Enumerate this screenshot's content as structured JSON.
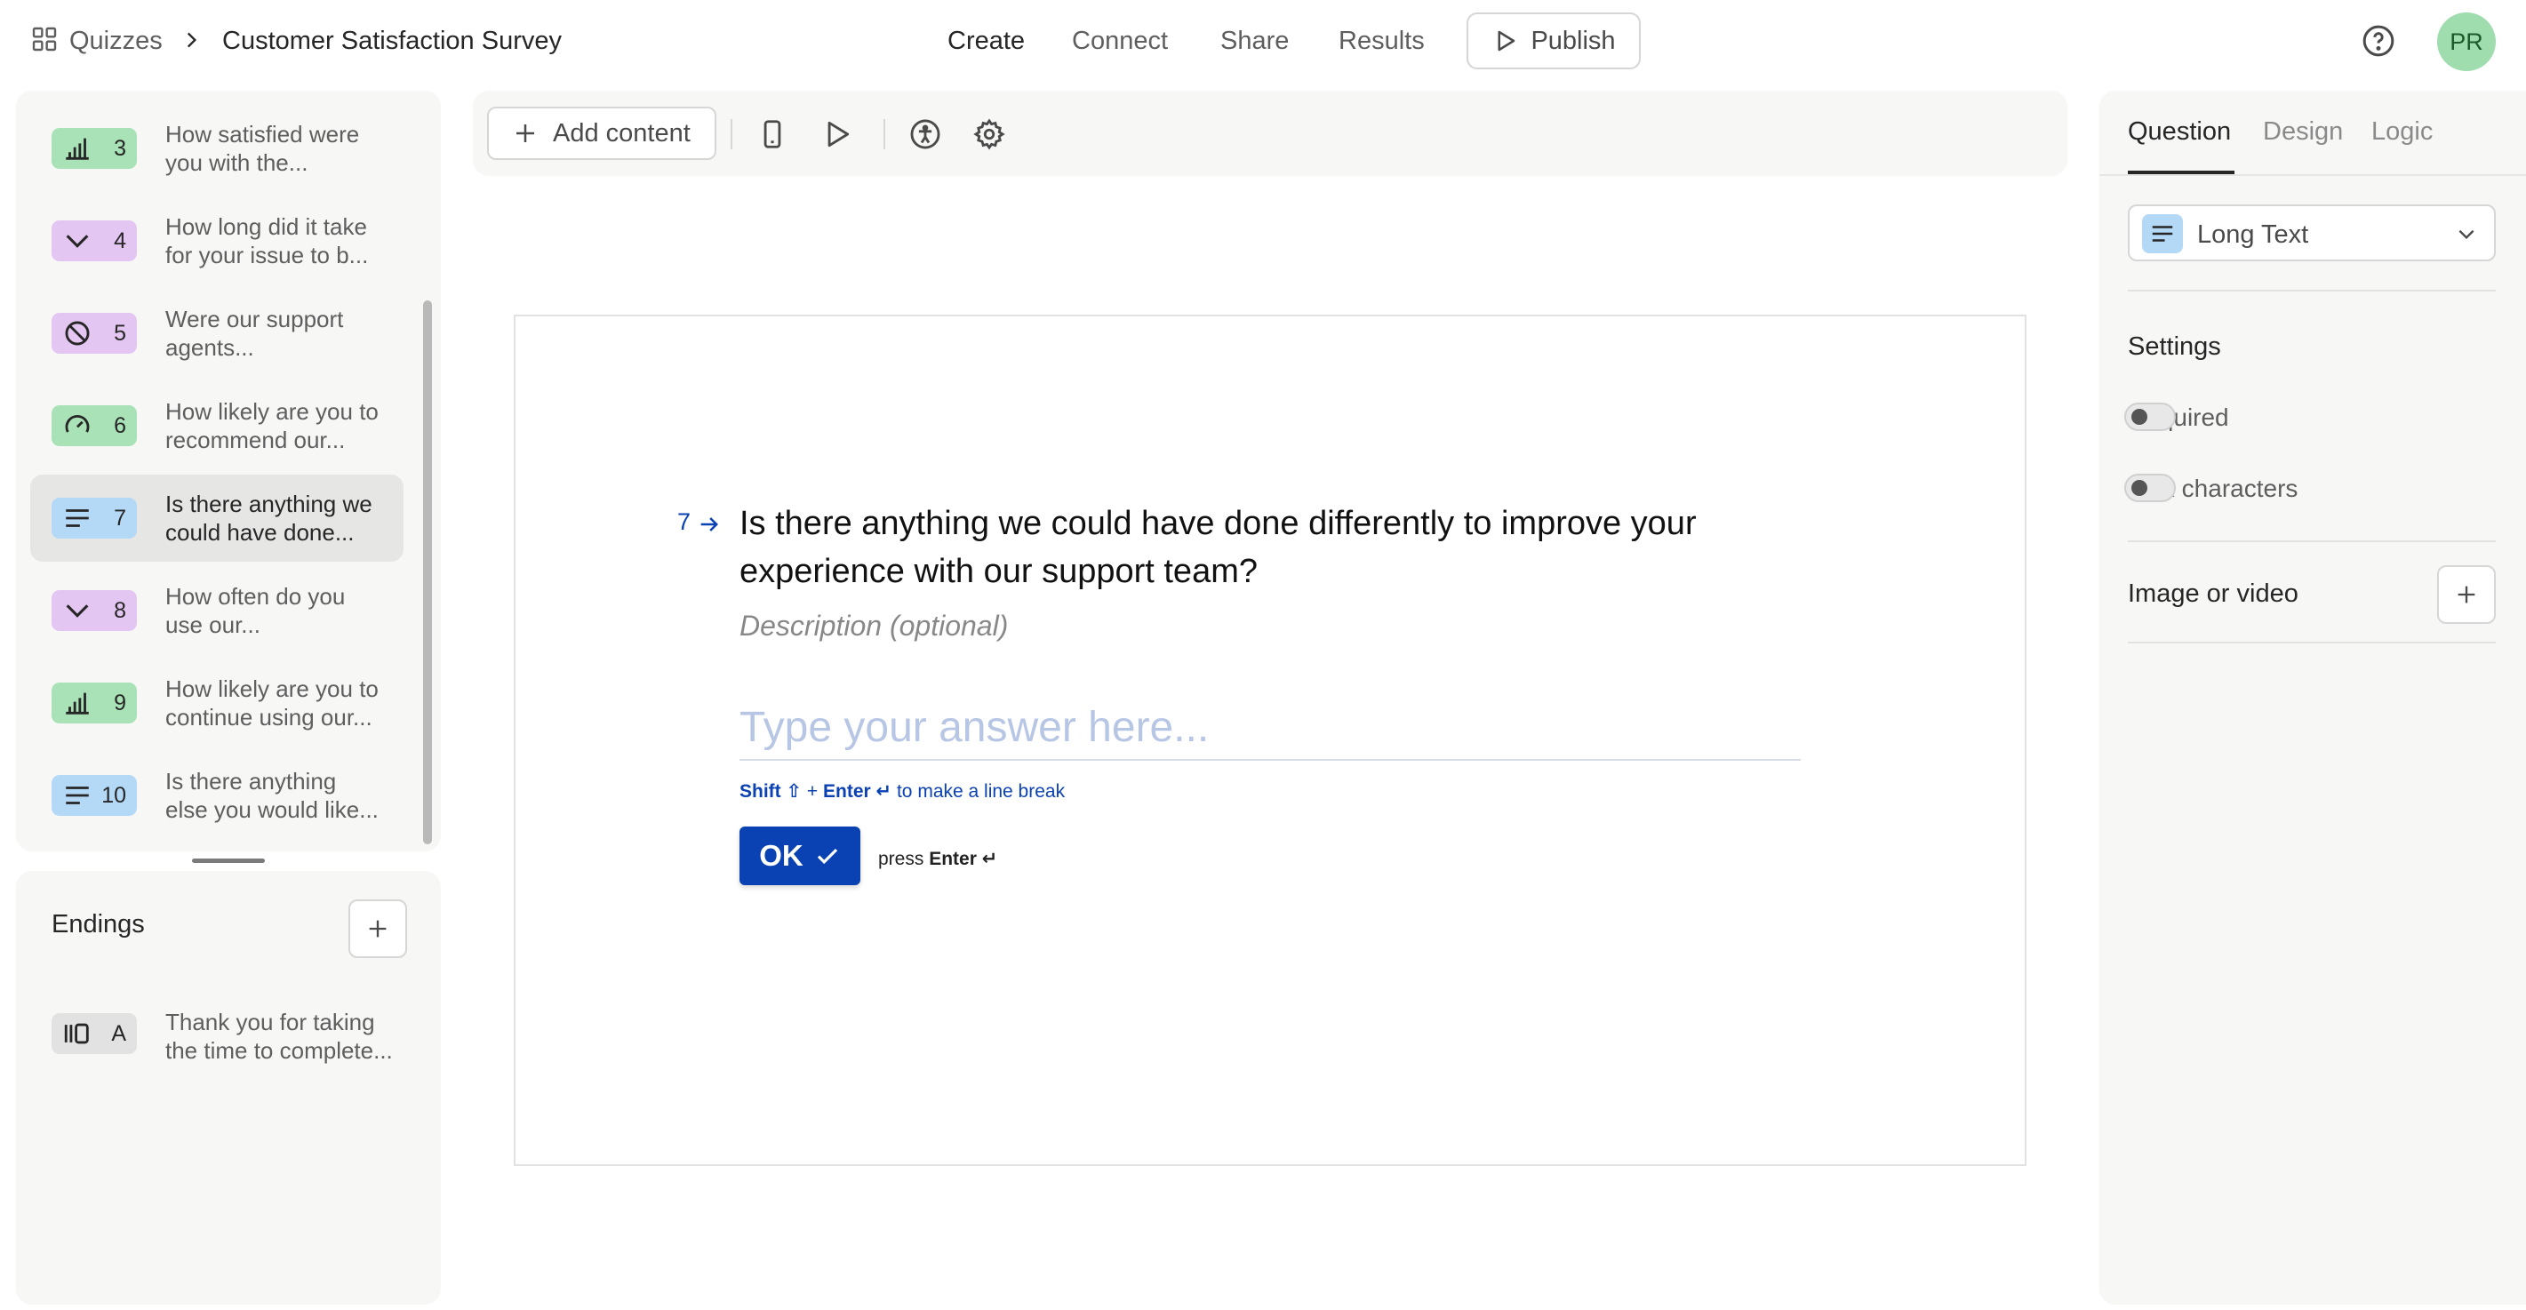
{
  "breadcrumb": {
    "root": "Quizzes",
    "current": "Customer Satisfaction Survey"
  },
  "nav": {
    "create": "Create",
    "connect": "Connect",
    "share": "Share",
    "results": "Results",
    "publish": "Publish"
  },
  "user": {
    "initials": "PR"
  },
  "questions": [
    {
      "num": "3",
      "line1": "How satisfied were",
      "line2": "you with the...",
      "icon": "bar-chart-icon"
    },
    {
      "num": "4",
      "line1": "How long did it take",
      "line2": "for your issue to b...",
      "icon": "chevron-down-icon"
    },
    {
      "num": "5",
      "line1": "Were our support",
      "line2": "agents...",
      "icon": "circle-slash-icon"
    },
    {
      "num": "6",
      "line1": "How likely are you to",
      "line2": "recommend our...",
      "icon": "gauge-icon"
    },
    {
      "num": "7",
      "line1": "Is there anything we",
      "line2": "could have done...",
      "icon": "long-text-icon"
    },
    {
      "num": "8",
      "line1": "How often do you",
      "line2": "use our...",
      "icon": "chevron-down-icon"
    },
    {
      "num": "9",
      "line1": "How likely are you to",
      "line2": "continue using our...",
      "icon": "bar-chart-icon"
    },
    {
      "num": "10",
      "line1": "Is there anything",
      "line2": "else you would like...",
      "icon": "long-text-icon"
    }
  ],
  "endings": {
    "title": "Endings",
    "items": [
      {
        "num": "A",
        "line1": "Thank you for taking",
        "line2": "the time to complete...",
        "icon": "ending-icon"
      }
    ]
  },
  "toolbar": {
    "add_content": "Add content"
  },
  "question": {
    "number": "7",
    "title": "Is there anything we could have done differently to improve your experience with our support team?",
    "description": "Description (optional)",
    "answer_placeholder": "Type your answer here...",
    "hint_shift": "Shift ⇧",
    "hint_plus": " + ",
    "hint_enter": "Enter ↵",
    "hint_rest": " to make a line break",
    "ok_label": "OK",
    "press": "press ",
    "press_enter": "Enter ↵"
  },
  "right_panel": {
    "tabs": [
      "Question",
      "Design",
      "Logic"
    ],
    "question_type": "Long Text",
    "settings_heading": "Settings",
    "required_label": "Required",
    "max_characters_label": "Max characters",
    "media_label": "Image or video",
    "required_on": false,
    "max_characters_on": false
  },
  "colors": {
    "brand_blue": "#0a42b4",
    "badge_green": "#a8e2b6",
    "badge_purple": "#e3c6f1",
    "badge_blue": "#b4d9f7",
    "avatar": "#9fdcae"
  }
}
